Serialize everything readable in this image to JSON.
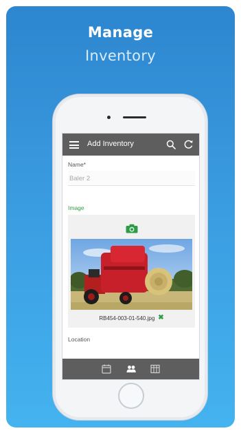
{
  "promo": {
    "headline": "Manage",
    "subline": "Inventory"
  },
  "app": {
    "title": "Add Inventory",
    "icons": [
      "menu-icon",
      "search-icon",
      "refresh-icon"
    ]
  },
  "form": {
    "name_label": "Name*",
    "name_value": "Baler 2",
    "image_label": "Image",
    "image_file": "RB454-003-01-540.jpg",
    "location_label": "Location"
  },
  "tabs": [
    "calendar-icon",
    "people-icon",
    "grid-icon"
  ],
  "colors": {
    "background_top": "#2d86cf",
    "background_bottom": "#44b3ef",
    "appbar": "#5e5e5e",
    "accent_green": "#2e9b46"
  }
}
